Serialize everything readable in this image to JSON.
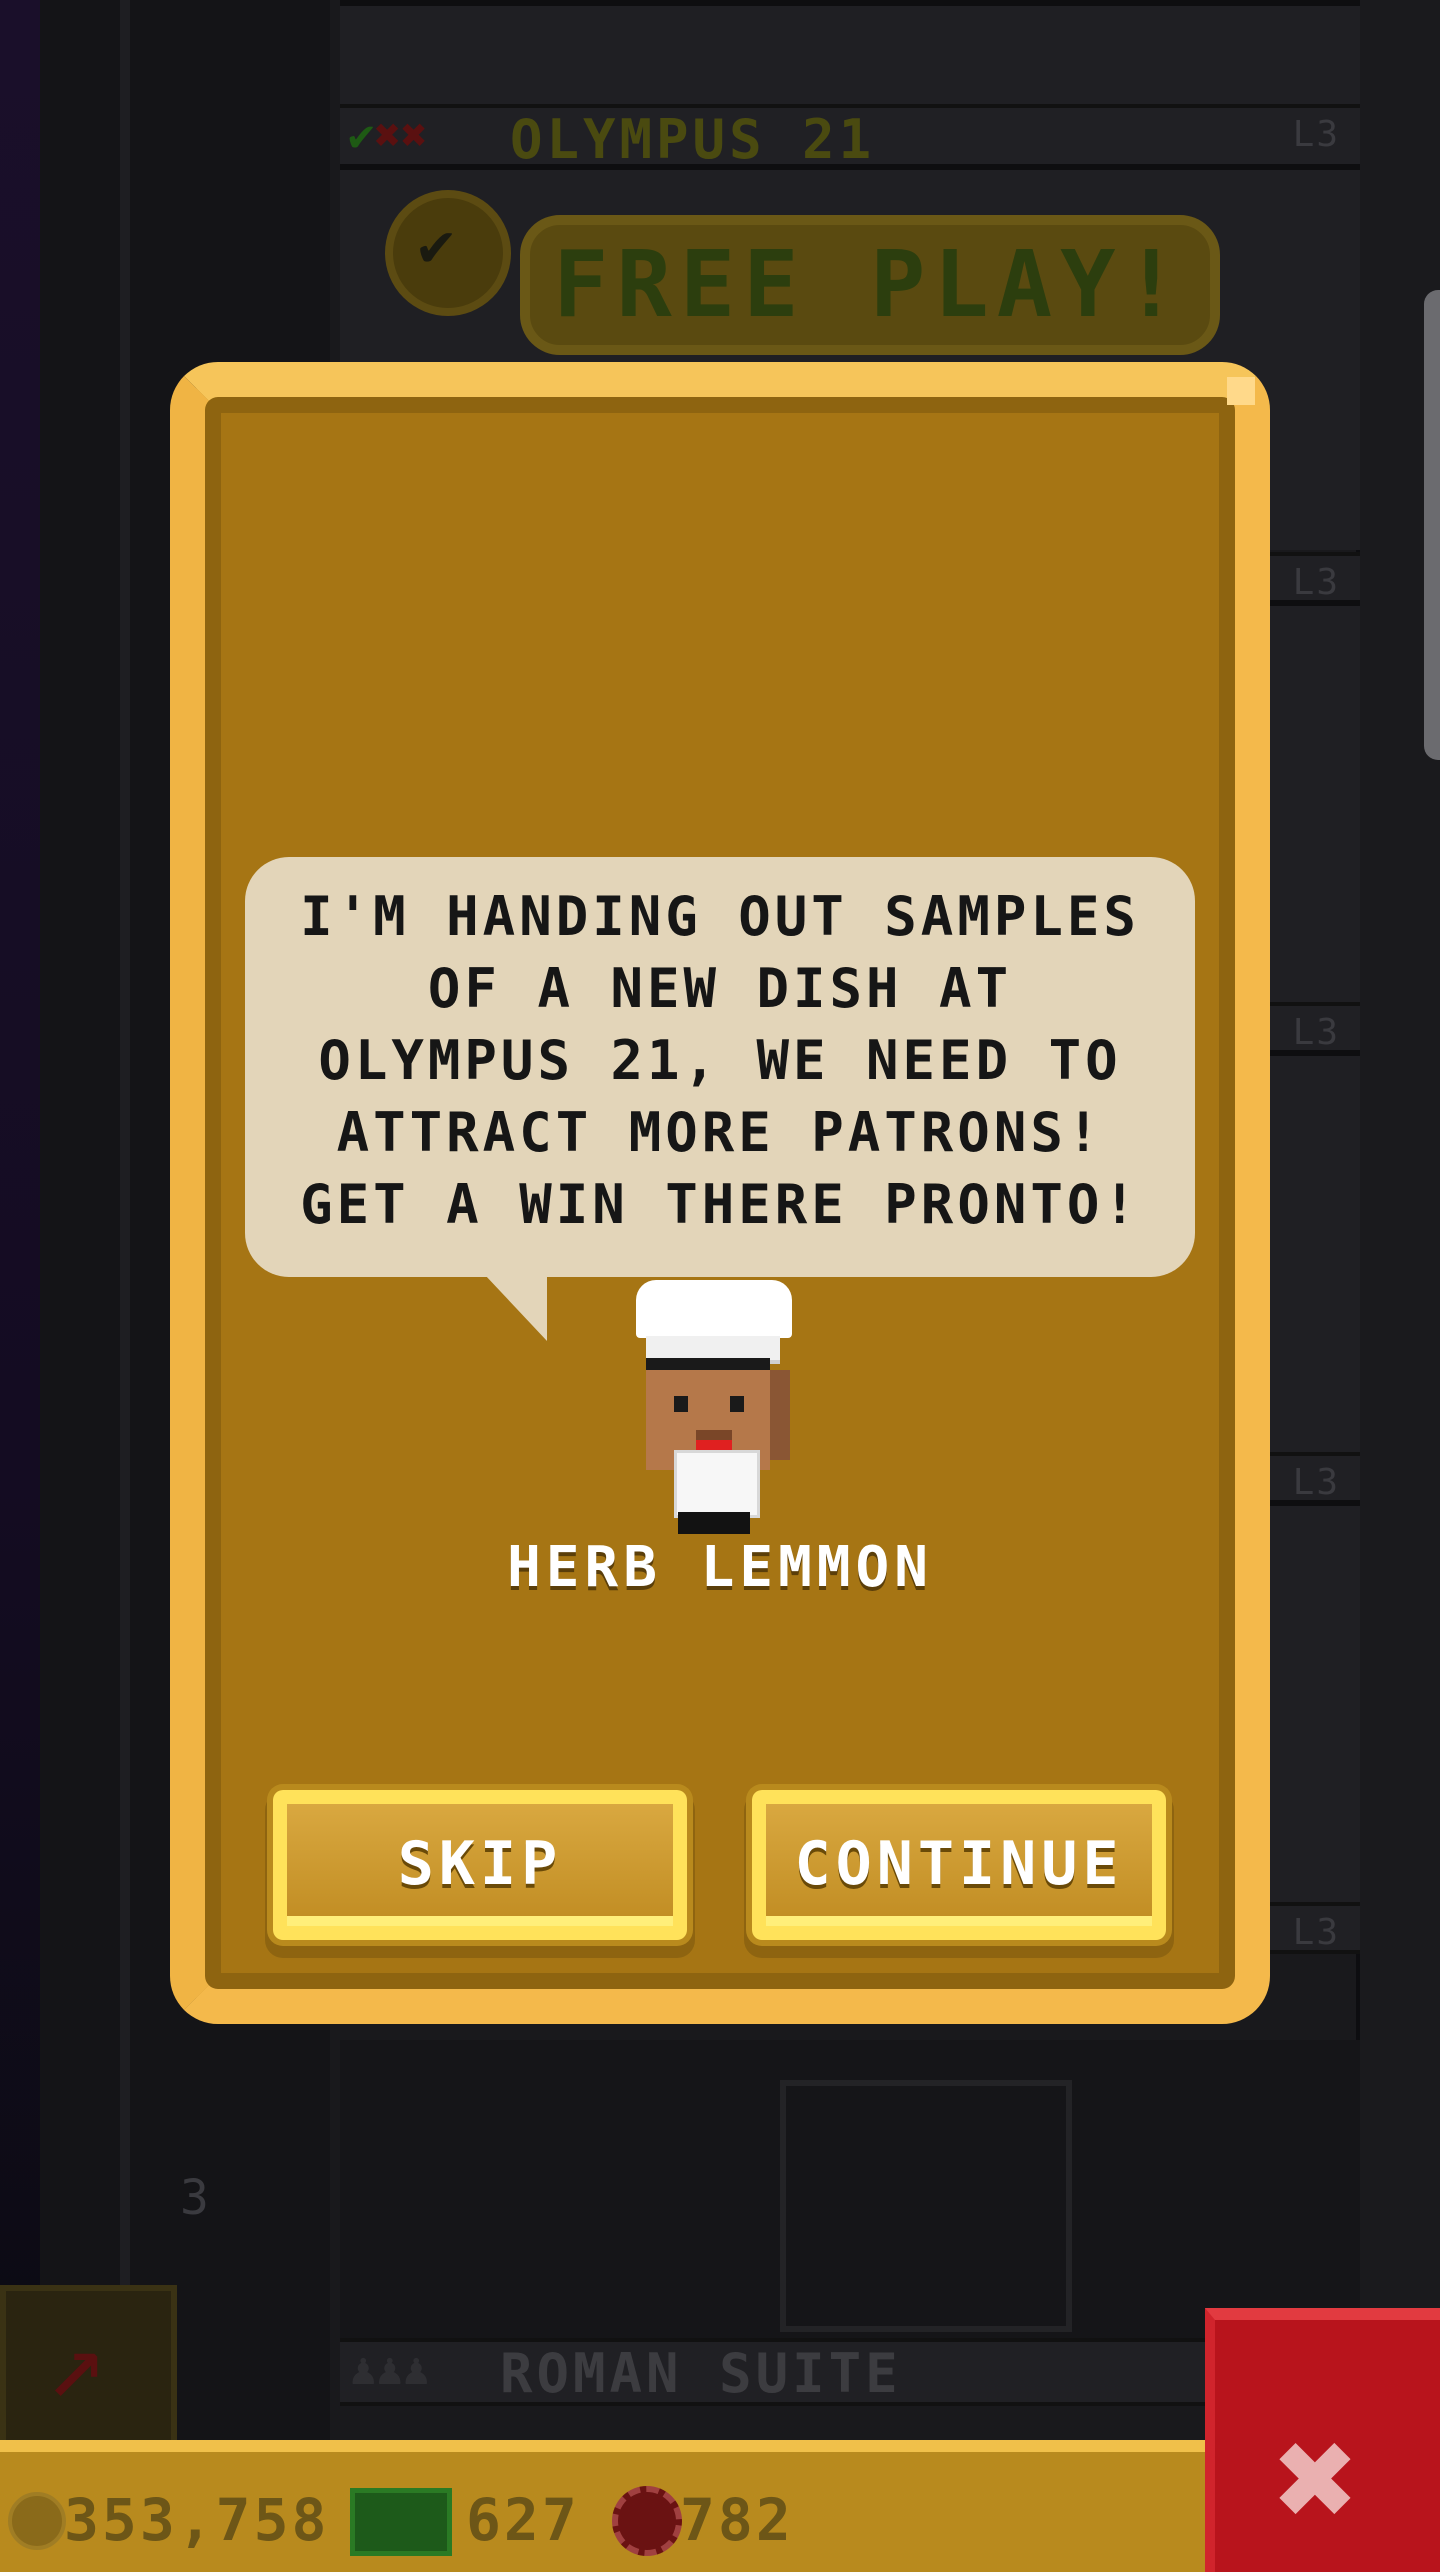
{
  "background": {
    "top_floor": {
      "name": "OLYMPUS 21",
      "level": "L3",
      "status_marks": [
        "✔",
        "✖",
        "✖"
      ]
    },
    "free_play_label": "FREE PLAY!",
    "floor_levels": [
      "L3",
      "L3",
      "L3",
      "L3",
      "L3"
    ],
    "bottom_floor": {
      "name": "ROMAN SUITE",
      "status_marks": [
        "♟",
        "♟",
        "♟"
      ]
    },
    "wall_number": "3"
  },
  "dialog": {
    "message": "I'M HANDING OUT SAMPLES\nOF A NEW DISH AT\nOLYMPUS 21, WE NEED TO\nATTRACT MORE PATRONS!\nGET A WIN THERE PRONTO!",
    "character_name": "HERB LEMMON",
    "skip_label": "SKIP",
    "continue_label": "CONTINUE"
  },
  "hud": {
    "coins": "353,758",
    "cash": "627",
    "chips": "782"
  },
  "icons": {
    "coin": "coin-icon",
    "cash": "cash-icon",
    "chip": "chip-icon",
    "close": "close-icon",
    "rocket": "rocket-icon"
  },
  "colors": {
    "dialog_fill": "#a67514",
    "dialog_border": "#f4b94b",
    "bubble": "#e3d5b9",
    "button_glow": "#ffe25a",
    "close_red": "#b8141c"
  }
}
